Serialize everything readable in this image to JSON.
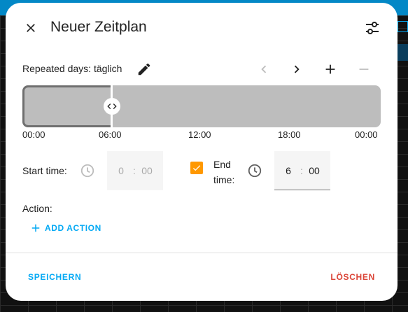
{
  "dialog": {
    "title": "Neuer Zeitplan",
    "repeat_text": "Repeated days: täglich",
    "timeline_ticks": [
      "00:00",
      "06:00",
      "12:00",
      "18:00",
      "00:00"
    ],
    "start_time": {
      "label": "Start time:",
      "hours": "0",
      "separator": ":",
      "minutes": "00"
    },
    "end_time": {
      "label_line1": "End",
      "label_line2": "time:",
      "checked": true,
      "hours": "6",
      "separator": ":",
      "minutes": "00"
    },
    "action": {
      "label": "Action:",
      "add_label": "ADD ACTION"
    },
    "footer": {
      "save_label": "SPEICHERN",
      "delete_label": "LÖSCHEN"
    }
  },
  "colors": {
    "accent": "#03a9f4",
    "checkbox": "#ff9800",
    "danger": "#db4437",
    "timeline": "#bdbdbd",
    "background_topbar": "#0388c6"
  },
  "icons": {
    "close": "close-icon",
    "settings": "tune-icon",
    "edit": "pencil-icon",
    "prev": "chevron-left-icon",
    "next": "chevron-right-icon",
    "add": "plus-icon",
    "remove": "minus-icon",
    "handle": "resize-handle-icon",
    "clock": "clock-icon",
    "check": "check-icon"
  }
}
